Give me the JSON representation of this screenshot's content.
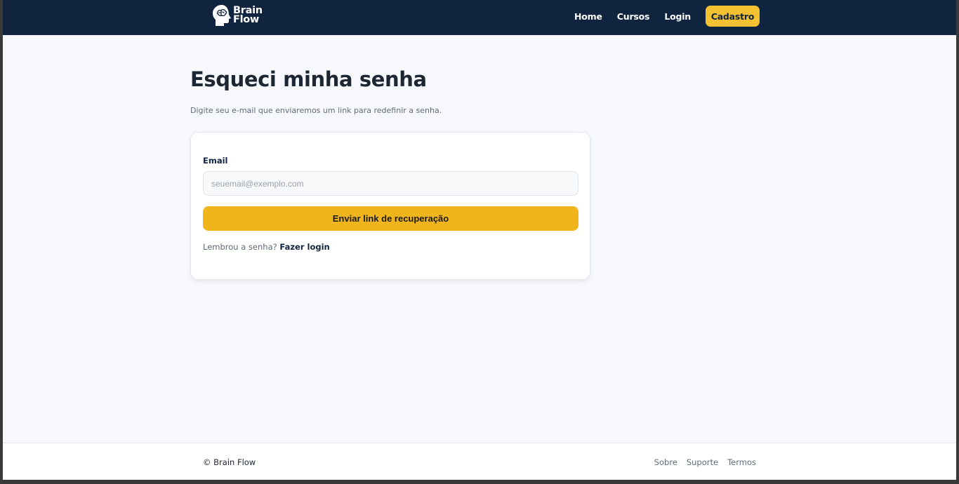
{
  "header": {
    "brand_line1": "Brain",
    "brand_line2": "Flow",
    "nav": {
      "home": "Home",
      "courses": "Cursos",
      "login": "Login",
      "signup": "Cadastro"
    }
  },
  "main": {
    "title": "Esqueci minha senha",
    "subtitle": "Digite seu e-mail que enviaremos um link para redefinir a senha.",
    "form": {
      "email_label": "Email",
      "email_value": "",
      "email_placeholder": "seuemail@exemplo.com",
      "submit_label": "Enviar link de recuperação",
      "remember_text": "Lembrou a senha?",
      "login_link": "Fazer login"
    }
  },
  "footer": {
    "copyright": "© Brain Flow",
    "links": {
      "about": "Sobre",
      "support": "Suporte",
      "terms": "Termos"
    }
  },
  "colors": {
    "navy": "#10233f",
    "accent_yellow": "#f4c230",
    "button_yellow": "#f0b41d",
    "page_bg": "#f6f8fb"
  },
  "icons": {
    "logo": "brain-head-icon"
  }
}
